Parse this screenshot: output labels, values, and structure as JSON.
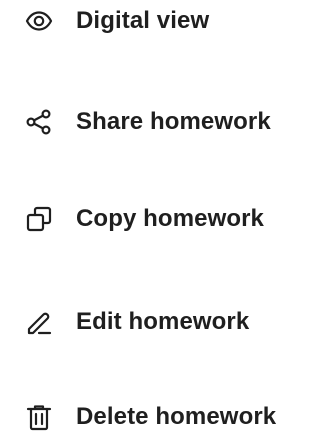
{
  "menu": {
    "items": [
      {
        "label": "Digital view",
        "icon": "eye-icon"
      },
      {
        "label": "Share homework",
        "icon": "share-icon"
      },
      {
        "label": "Copy homework",
        "icon": "copy-icon"
      },
      {
        "label": "Edit homework",
        "icon": "pencil-icon"
      },
      {
        "label": "Delete homework",
        "icon": "trash-icon"
      }
    ]
  },
  "colors": {
    "text": "#1f1f1f",
    "icon": "#1f1f1f",
    "background": "#ffffff"
  }
}
